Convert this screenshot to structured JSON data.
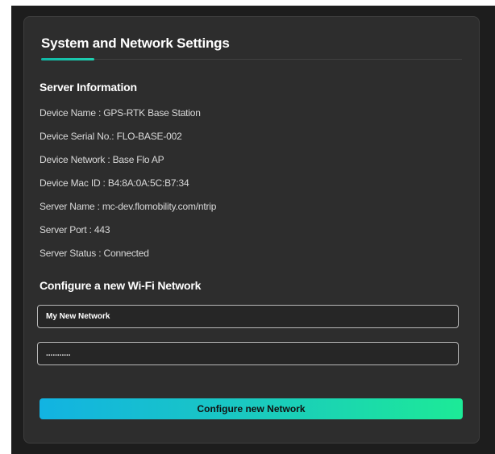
{
  "settings": {
    "title": "System and Network Settings",
    "server_info": {
      "heading": "Server Information",
      "rows": [
        "Device Name : GPS-RTK Base Station",
        "Device Serial No.: FLO-BASE-002",
        "Device Network : Base Flo AP",
        "Device Mac ID : B4:8A:0A:5C:B7:34",
        "Server Name : mc-dev.flomobility.com/ntrip",
        "Server Port : 443",
        "Server Status : Connected"
      ]
    },
    "wifi": {
      "heading": "Configure a new Wi-Fi Network",
      "network_name_value": "My New Network",
      "password_value": "...........",
      "submit_label": "Configure new Network"
    }
  },
  "colors": {
    "backdrop": "#1d1d1d",
    "card": "#2d2d2d",
    "accent_underline": "#11b8a6",
    "button_gradient_start": "#12b3e2",
    "button_gradient_end": "#1cea97"
  }
}
